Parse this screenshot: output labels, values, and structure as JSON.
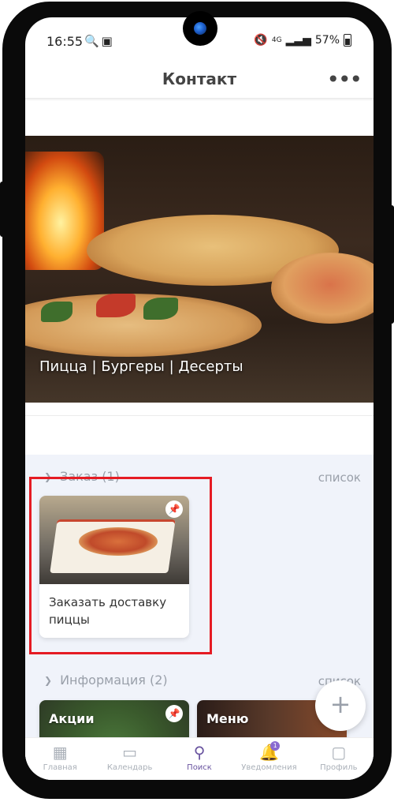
{
  "status_bar": {
    "time": "16:55",
    "signal": "4G",
    "battery": "57%"
  },
  "header": {
    "title": "Контакт"
  },
  "banner": {
    "caption": "Пицца | Бургеры | Десерты"
  },
  "sections": [
    {
      "title": "Заказ (1)",
      "list_label": "список",
      "cards": [
        {
          "title": "Заказать доставку пиццы"
        }
      ]
    },
    {
      "title": "Информация (2)",
      "list_label": "список",
      "cards": [
        {
          "title": "Акции"
        },
        {
          "title": "Меню"
        }
      ]
    }
  ],
  "fab": {
    "symbol": "+"
  },
  "tabs": [
    {
      "label": "Главная",
      "icon": "grid-icon"
    },
    {
      "label": "Календарь",
      "icon": "calendar-icon"
    },
    {
      "label": "Поиск",
      "icon": "search-icon",
      "active": true
    },
    {
      "label": "Уведомления",
      "icon": "bell-icon",
      "badge": "1"
    },
    {
      "label": "Профиль",
      "icon": "profile-card-icon"
    }
  ],
  "colors": {
    "accent": "#6a55a0",
    "highlight": "#e51b23",
    "section_bg": "#f0f3fa"
  }
}
